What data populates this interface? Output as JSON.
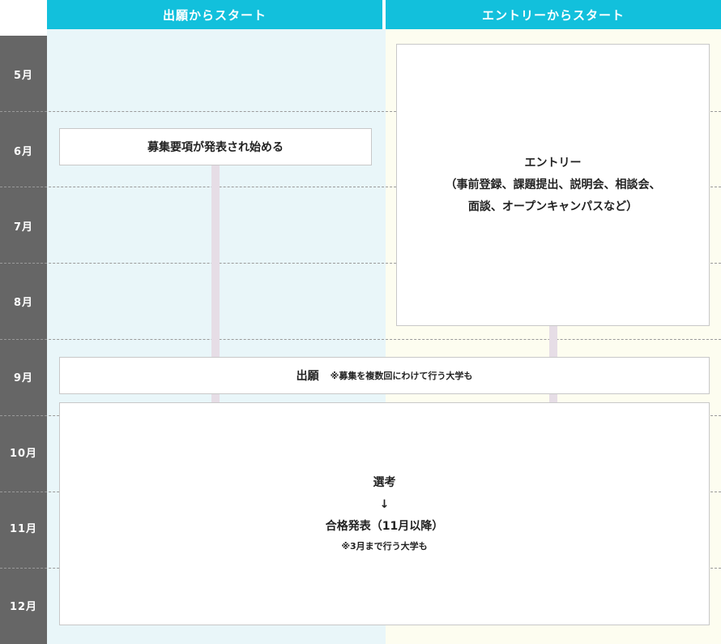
{
  "colors": {
    "header": "#12c0dc",
    "col_left_bg": "#e9f6f9",
    "col_right_bg": "#fdfdf0",
    "month_bg": "#666666",
    "connector": "#e6dde6",
    "box_border": "#c8c8c8"
  },
  "headers": {
    "left": "出願からスタート",
    "right": "エントリーからスタート"
  },
  "months": [
    "5月",
    "6月",
    "7月",
    "8月",
    "9月",
    "10月",
    "11月",
    "12月"
  ],
  "steps": {
    "recruitment": "募集要項が発表され始める",
    "entry": {
      "line1": "エントリー",
      "line2": "（事前登録、課題提出、説明会、相談会、",
      "line3": "面談、オープンキャンパスなど）"
    },
    "application": {
      "title": "出願",
      "note": "※募集を複数回にわけて行う大学も"
    },
    "selection": {
      "line1": "選考",
      "arrow": "↓",
      "line2": "合格発表（11月以降）",
      "note": "※3月まで行う大学も"
    }
  }
}
